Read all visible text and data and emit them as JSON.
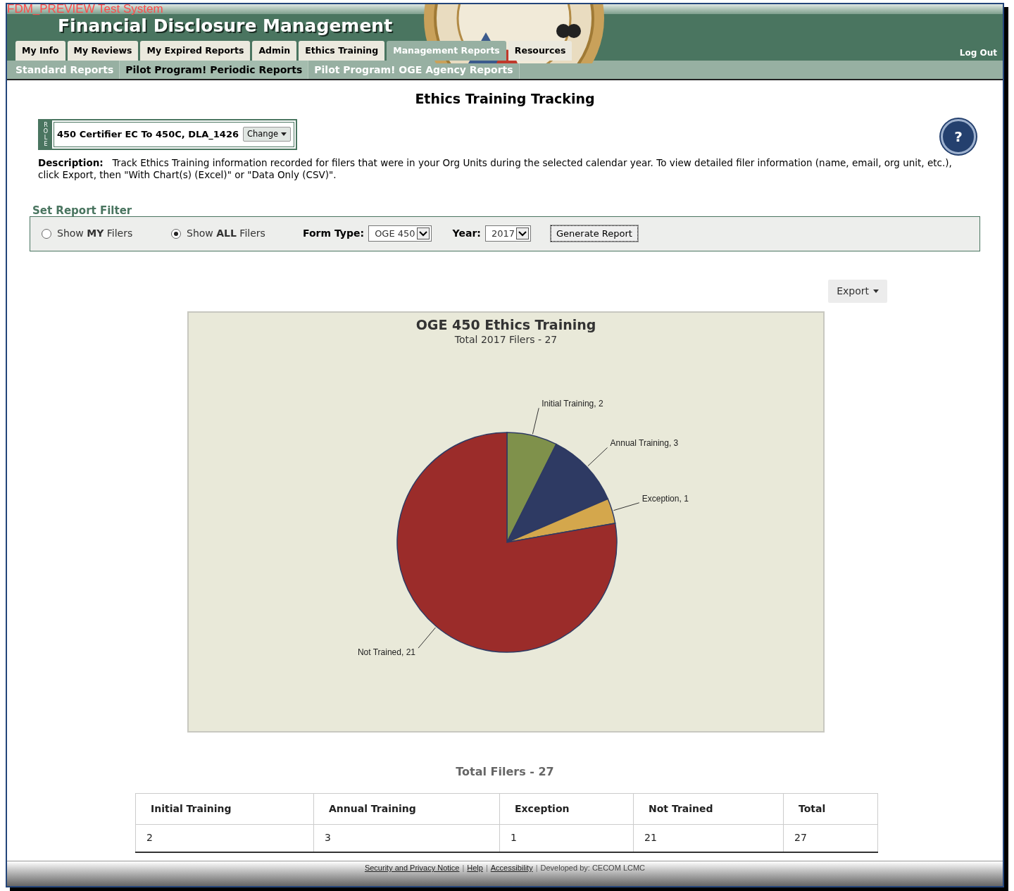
{
  "header": {
    "system_label": "FDM_PREVIEW Test System",
    "title": "Financial Disclosure Management",
    "logout": "Log Out"
  },
  "tabs": [
    {
      "label": "My Info",
      "selected": false
    },
    {
      "label": "My Reviews",
      "selected": false
    },
    {
      "label": "My Expired Reports",
      "selected": false
    },
    {
      "label": "Admin",
      "selected": false
    },
    {
      "label": "Ethics Training",
      "selected": false
    },
    {
      "label": "Management Reports",
      "selected": true
    },
    {
      "label": "Resources",
      "selected": false
    }
  ],
  "subtabs": [
    {
      "label": "Standard Reports",
      "selected": false
    },
    {
      "label": "Pilot Program! Periodic Reports",
      "selected": true
    },
    {
      "label": "Pilot Program! OGE Agency Reports",
      "selected": false
    }
  ],
  "page_title": "Ethics Training Tracking",
  "role": {
    "tag": "ROLE",
    "value": "450 Certifier EC To 450C, DLA_1426",
    "button": "Change"
  },
  "help": "?",
  "description": {
    "label": "Description:",
    "text": "Track Ethics Training information recorded for filers that were in your Org Units during the selected calendar year. To view detailed filer information (name, email, org unit, etc.), click Export, then \"With Chart(s) (Excel)\" or \"Data Only (CSV)\"."
  },
  "filter": {
    "title": "Set Report Filter",
    "radios": [
      {
        "label": "Show **MY** Filers",
        "selected": false
      },
      {
        "label": "Show **ALL** Filers",
        "selected": true
      }
    ],
    "form_type": {
      "label": "Form Type:",
      "value": "OGE 450"
    },
    "year": {
      "label": "Year:",
      "value": "2017"
    },
    "button": "Generate Report"
  },
  "export": "Export",
  "chart": {
    "subtitle": "Total 2017 Filers - 27",
    "chart_data": {
      "type": "pie",
      "title": "OGE 450 Ethics Training",
      "categories": [
        "Initial Training, 2",
        "Annual Training, 3",
        "Exception, 1",
        "Not Trained, 21"
      ],
      "series": [
        {
          "values": [
            2,
            3,
            1,
            21
          ]
        }
      ]
    }
  },
  "totals_title": "Total Filers - 27",
  "table": {
    "columns": [
      "Initial Training",
      "Annual Training",
      "Exception",
      "Not Trained",
      "Total"
    ],
    "rows": [
      [
        "2",
        "3",
        "1",
        "21",
        "27"
      ]
    ]
  },
  "footer": {
    "items": [
      {
        "kind": "link",
        "text": "Security and Privacy Notice"
      },
      {
        "kind": "separator",
        "text": "|"
      },
      {
        "kind": "link",
        "text": "Help"
      },
      {
        "kind": "separator",
        "text": "|"
      },
      {
        "kind": "link",
        "text": "Accessibility"
      },
      {
        "kind": "separator",
        "text": "|"
      },
      {
        "kind": "text",
        "text": "Developed by: CECOM LCMC"
      }
    ]
  }
}
